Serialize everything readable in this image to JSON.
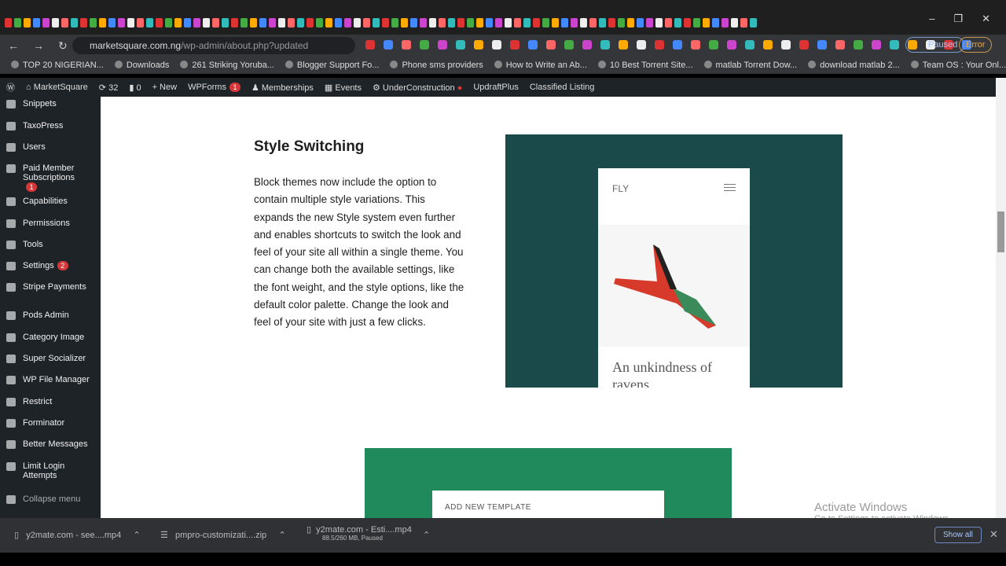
{
  "browser": {
    "url_host": "marketsquare.com.ng",
    "url_path": "/wp-admin/about.php?updated",
    "profile_status": "Paused",
    "error_label": "Error",
    "bookmarks": [
      "TOP 20 NIGERIAN...",
      "Downloads",
      "261 Striking Yoruba...",
      "Blogger Support Fo...",
      "Phone sms providers",
      "How to Write an Ab...",
      "10 Best Torrent Site...",
      "matlab Torrent Dow...",
      "download matlab 2...",
      "Team OS : Your Onl..."
    ]
  },
  "adminbar": {
    "site": "MarketSquare",
    "updates": "32",
    "comments": "0",
    "new": "New",
    "wpforms": "WPForms",
    "wpforms_badge": "1",
    "memberships": "Memberships",
    "events": "Events",
    "underconstruction": "UnderConstruction",
    "updraft": "UpdraftPlus",
    "classified": "Classified Listing"
  },
  "sidebar": {
    "items": [
      {
        "label": "Snippets",
        "icon": "scissors-icon"
      },
      {
        "label": "TaxoPress",
        "icon": "tag-icon"
      },
      {
        "label": "Users",
        "icon": "user-icon"
      },
      {
        "label": "Paid Member Subscriptions",
        "icon": "member-icon",
        "badge": "1"
      },
      {
        "label": "Capabilities",
        "icon": "key-icon"
      },
      {
        "label": "Permissions",
        "icon": "lock-icon"
      },
      {
        "label": "Tools",
        "icon": "wrench-icon"
      },
      {
        "label": "Settings",
        "icon": "settings-icon",
        "badge": "2"
      },
      {
        "label": "Stripe Payments",
        "icon": "stripe-icon"
      },
      {
        "label": "Pods Admin",
        "icon": "pods-icon"
      },
      {
        "label": "Category Image",
        "icon": "image-icon"
      },
      {
        "label": "Super Socializer",
        "icon": "socializer-icon"
      },
      {
        "label": "WP File Manager",
        "icon": "folder-icon"
      },
      {
        "label": "Restrict",
        "icon": "lock-icon"
      },
      {
        "label": "Forminator",
        "icon": "clipboard-icon"
      },
      {
        "label": "Better Messages",
        "icon": "messages-icon"
      },
      {
        "label": "Limit Login Attempts",
        "icon": "fingerprint-icon"
      },
      {
        "label": "Collapse menu",
        "icon": "collapse-icon"
      }
    ]
  },
  "main": {
    "title": "Style Switching",
    "body": "Block themes now include the option to contain multiple style variations. This expands the new Style system even further and enables shortcuts to switch the look and feel of your site all within a single theme. You can change both the available settings, like the font weight, and the style options, like the default color palette. Change the look and feel of your site with just a few clicks.",
    "preview_brand": "FLY",
    "preview_caption": "An unkindness of ravens",
    "template_label": "ADD NEW TEMPLATE",
    "colors": {
      "hero": "#1b4a4a",
      "hero2": "#218a5d"
    }
  },
  "watermark": {
    "title": "Activate Windows",
    "subtitle": "Go to Settings to activate Windows."
  },
  "downloads": {
    "items": [
      {
        "name": "y2mate.com - see....mp4"
      },
      {
        "name": "pmpro-customizati....zip"
      },
      {
        "name": "y2mate.com - Esti....mp4",
        "status": "88.5/260 MB, Paused"
      }
    ],
    "show_all": "Show all"
  }
}
